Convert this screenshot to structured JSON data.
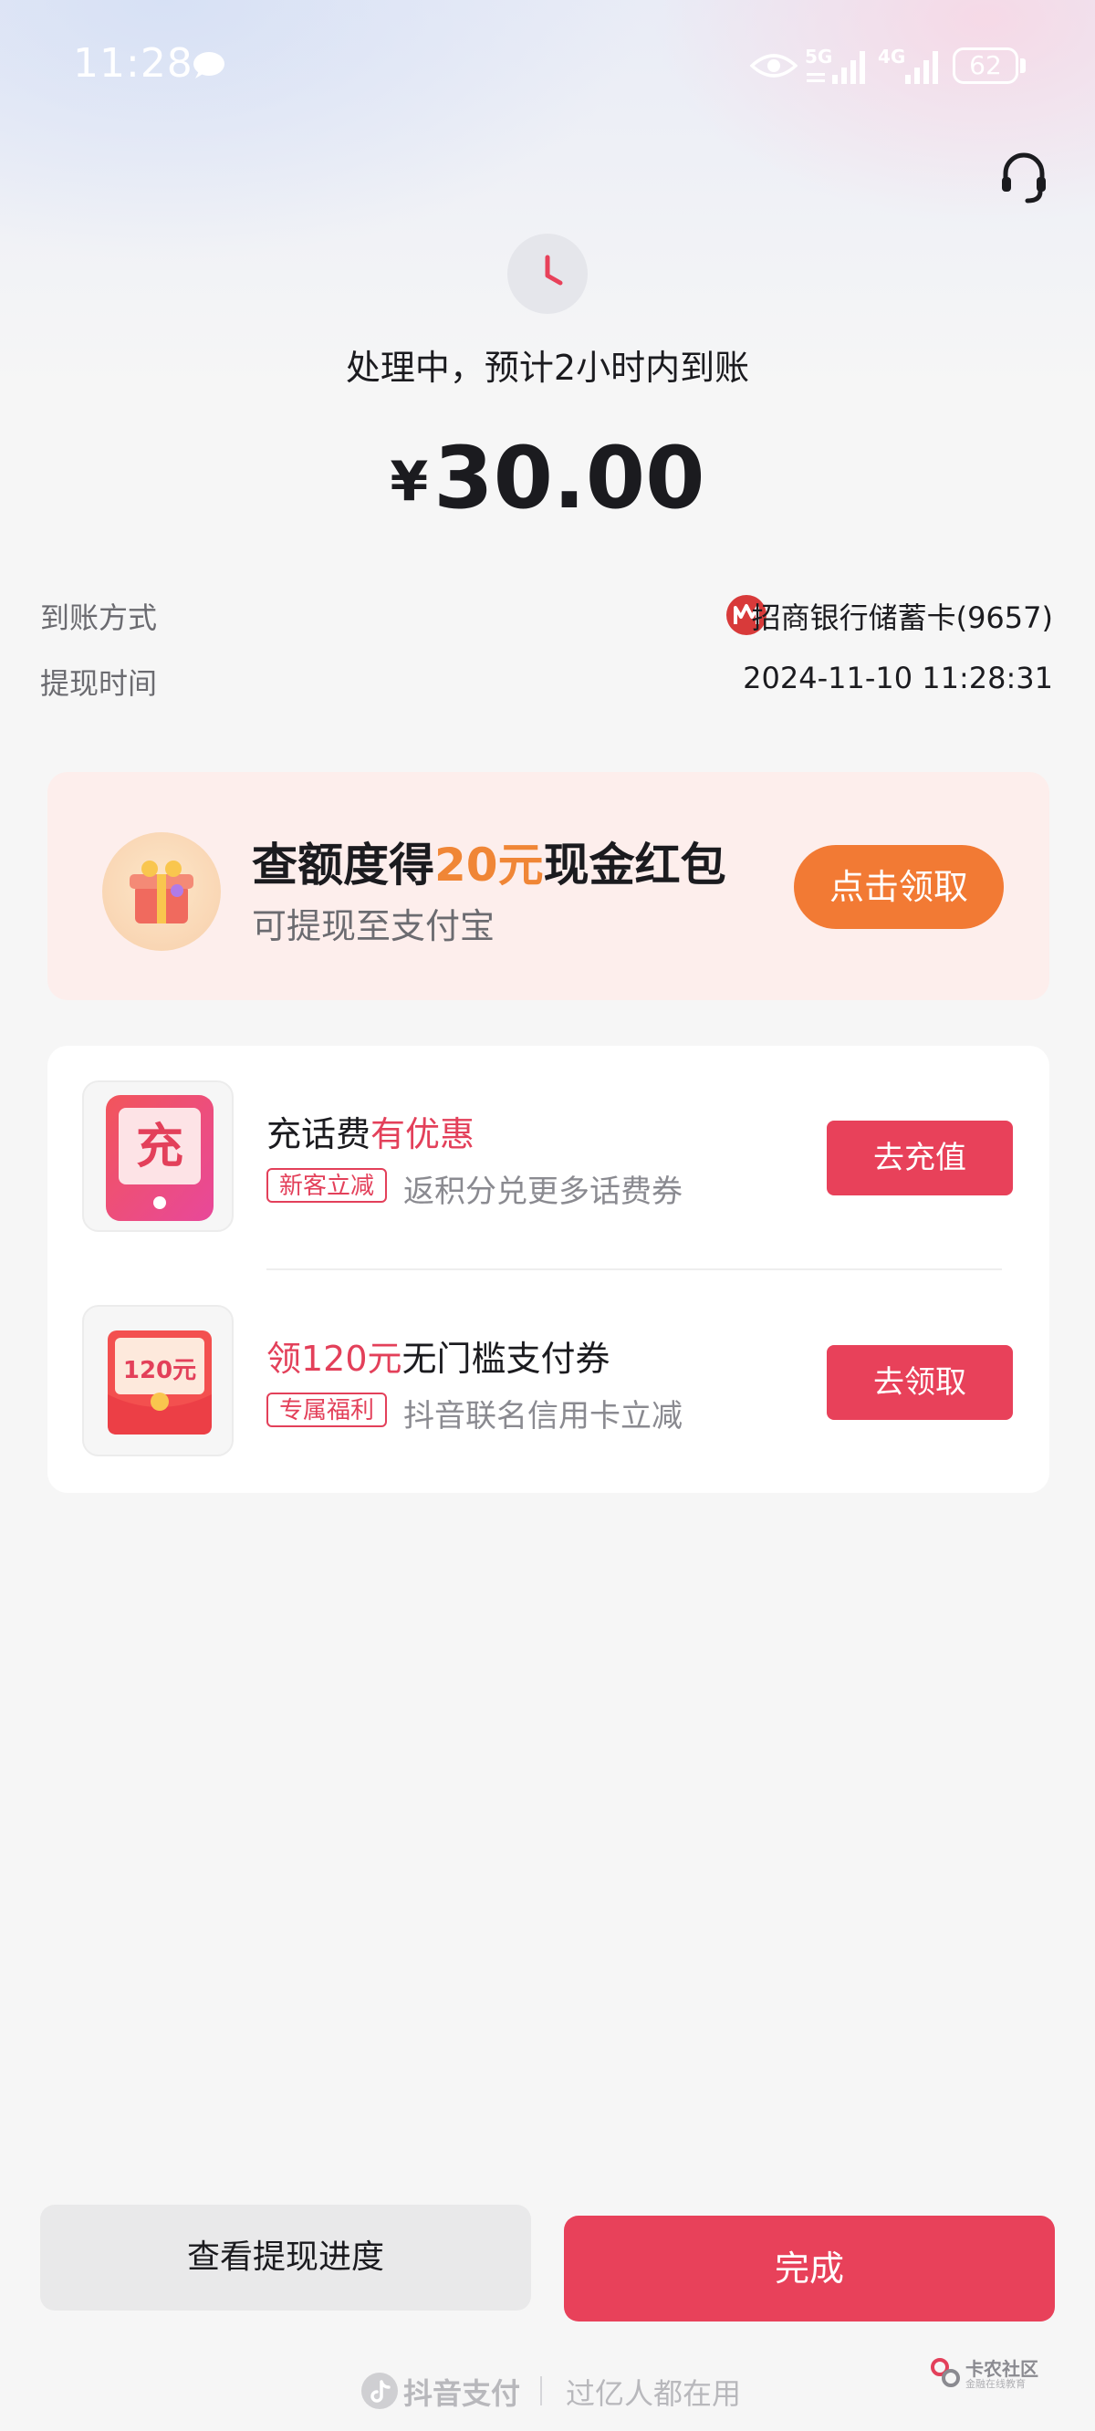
{
  "status_bar": {
    "time": "11:28",
    "net1": "5G",
    "net2": "4G",
    "battery": "62"
  },
  "header": {
    "status_text": "处理中，预计2小时内到账",
    "currency": "¥",
    "amount": "30.00"
  },
  "details": {
    "method_label": "到账方式",
    "method_value": "招商银行储蓄卡(9657)",
    "time_label": "提现时间",
    "time_value": "2024-11-10 11:28:31"
  },
  "promo": {
    "title_prefix": "查额度得",
    "title_highlight": "20元",
    "title_suffix": "现金红包",
    "subtitle": "可提现至支付宝",
    "button": "点击领取"
  },
  "offers": [
    {
      "icon_text": "充",
      "title_prefix": "充话费",
      "title_highlight": "有优惠",
      "title_suffix": "",
      "tag": "新客立减",
      "desc": "返积分兑更多话费券",
      "button": "去充值"
    },
    {
      "icon_text": "120元",
      "title_prefix": "",
      "title_highlight": "领120元",
      "title_suffix": "无门槛支付券",
      "tag": "专属福利",
      "desc": "抖音联名信用卡立减",
      "button": "去领取"
    }
  ],
  "bottom": {
    "progress_button": "查看提现进度",
    "done_button": "完成"
  },
  "footer": {
    "brand": "抖音支付",
    "slogan": "过亿人都在用"
  },
  "watermark": {
    "text": "卡农社区",
    "sub": "金融在线教育"
  },
  "colors": {
    "accent_red": "#e8415a",
    "promo_orange": "#f27a34"
  }
}
